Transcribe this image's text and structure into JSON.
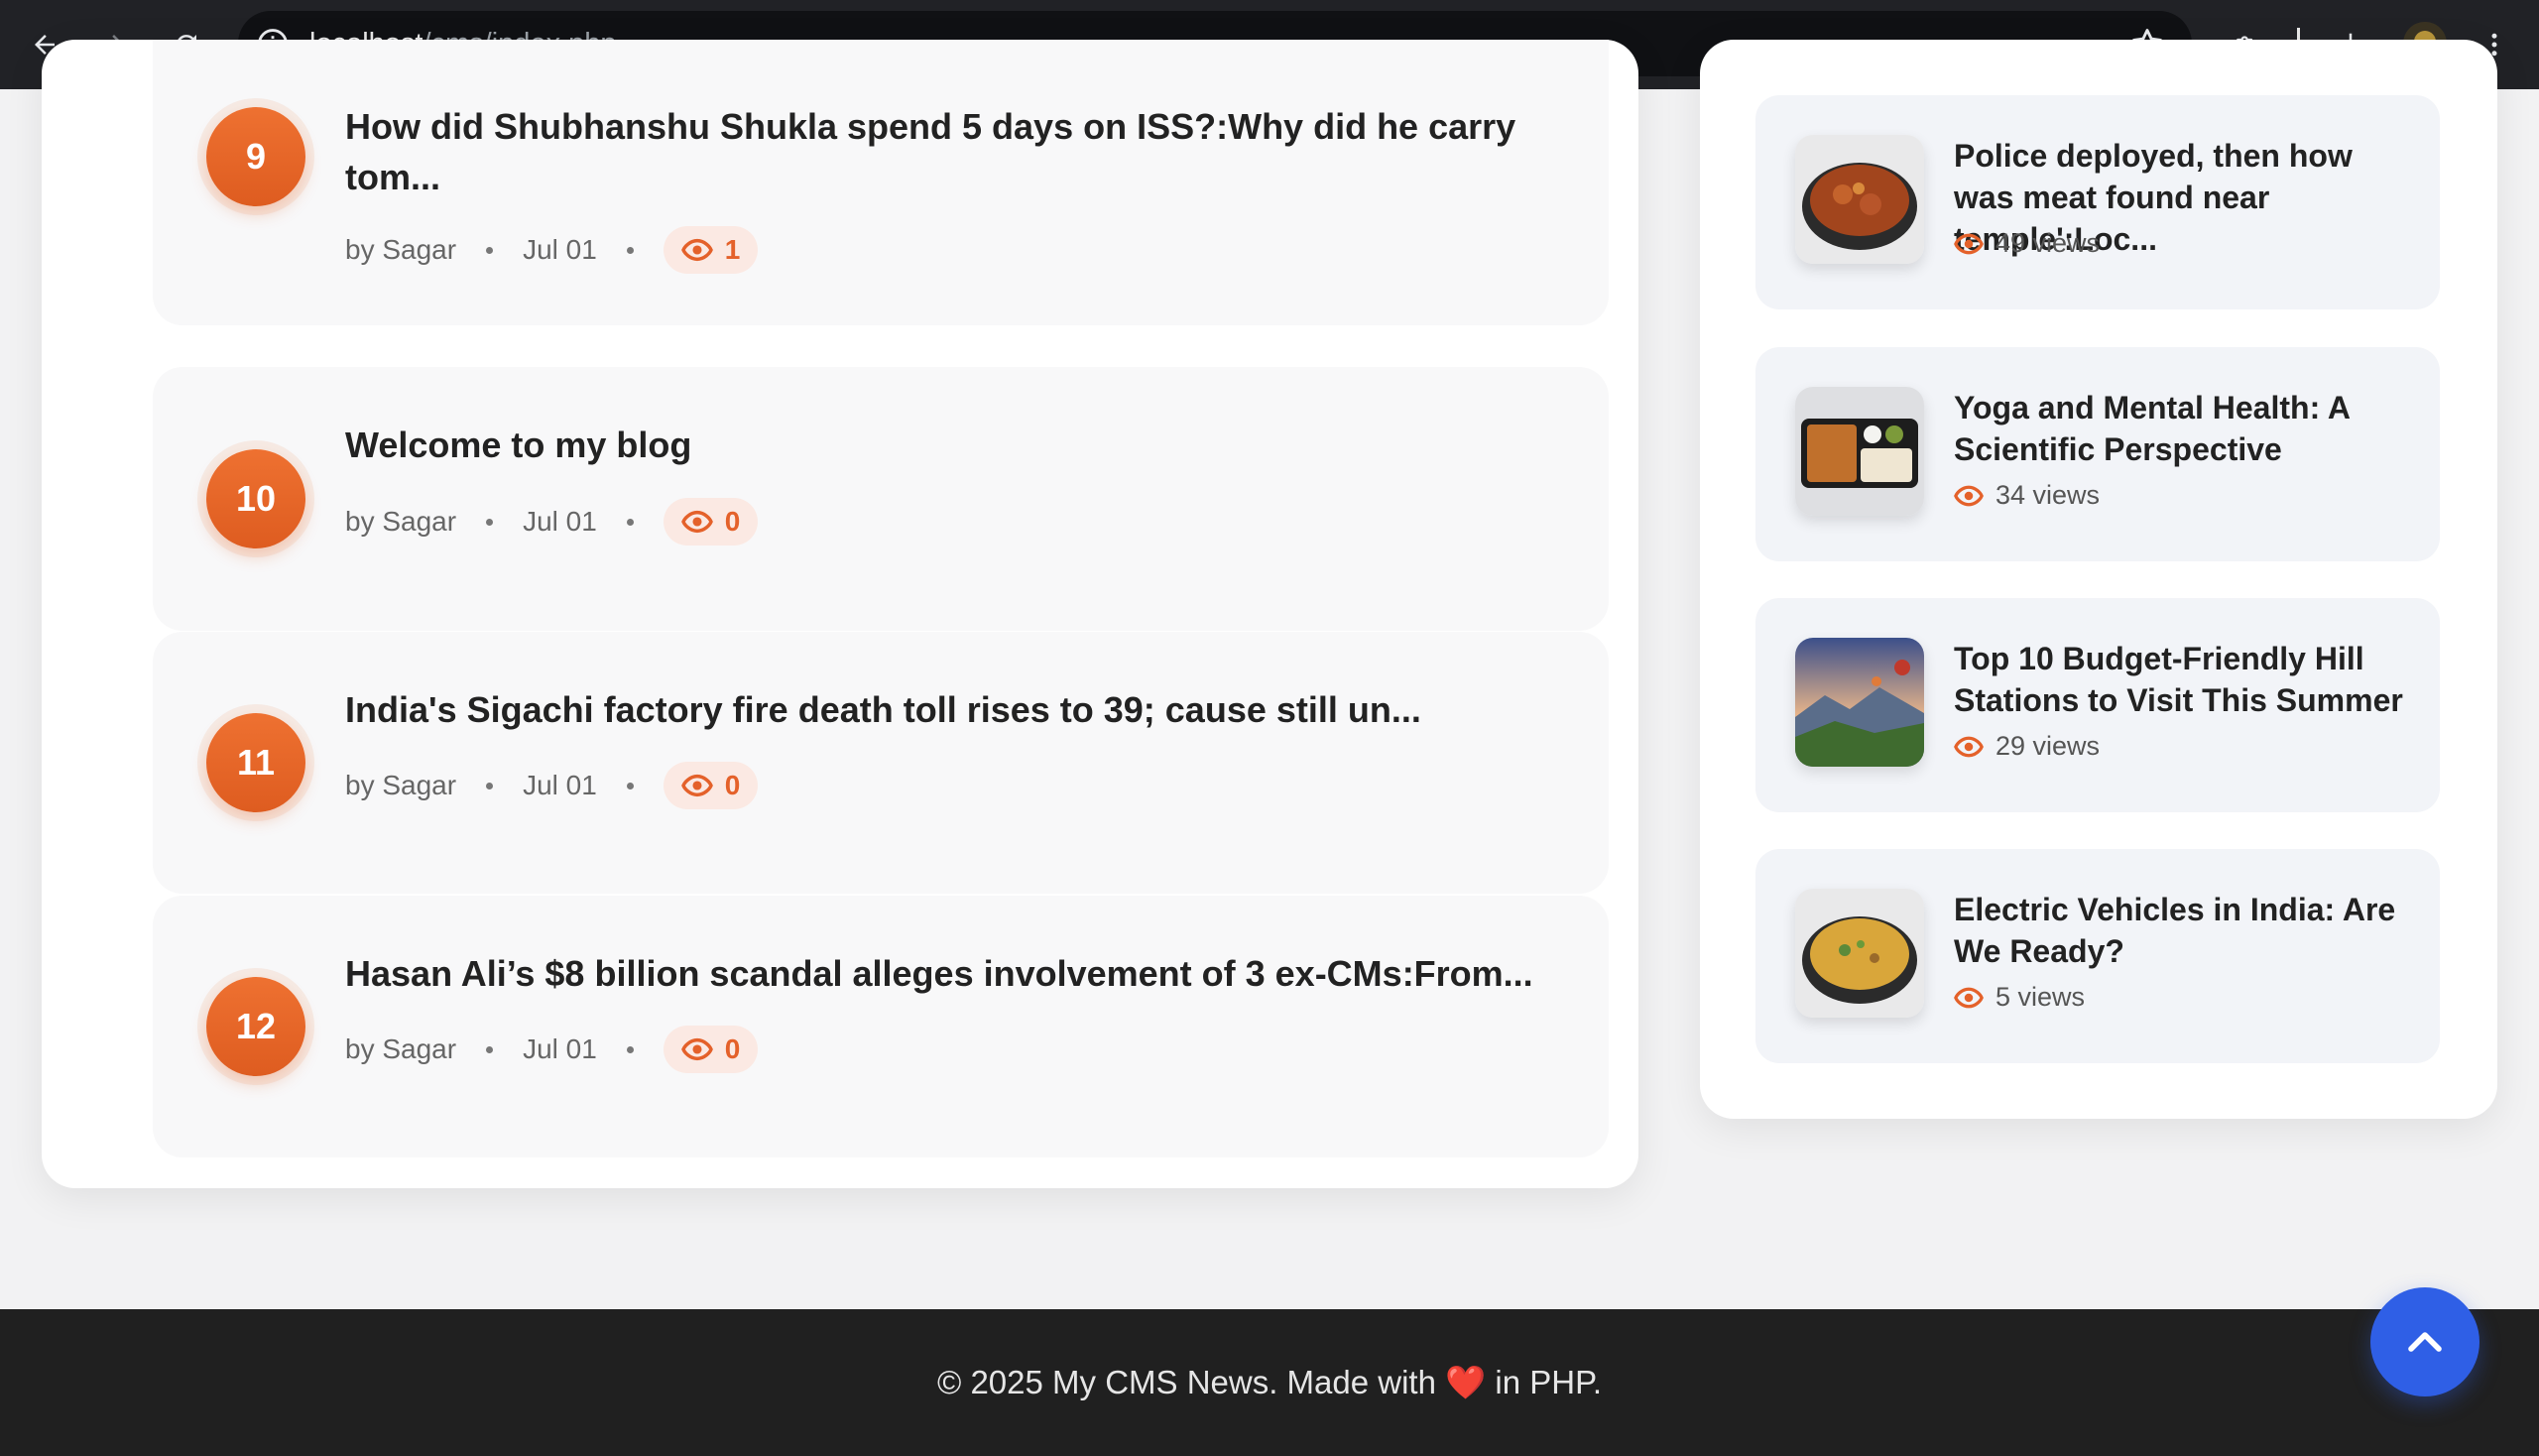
{
  "browser": {
    "url_host": "localhost",
    "url_path": "/cms/index.php"
  },
  "posts": [
    {
      "rank": "9",
      "title": "How did Shubhanshu Shukla spend 5 days on ISS?:Why did he carry tom...",
      "author": "by Sagar",
      "date": "Jul 01",
      "views": "1"
    },
    {
      "rank": "10",
      "title": "Welcome to my blog",
      "author": "by Sagar",
      "date": "Jul 01",
      "views": "0"
    },
    {
      "rank": "11",
      "title": "India's Sigachi factory fire death toll rises to 39; cause still un...",
      "author": "by Sagar",
      "date": "Jul 01",
      "views": "0"
    },
    {
      "rank": "12",
      "title": "Hasan Ali’s $8 billion scandal alleges involvement of 3 ex-CMs:From...",
      "author": "by Sagar",
      "date": "Jul 01",
      "views": "0"
    }
  ],
  "sidebar": {
    "items": [
      {
        "title": "Police deployed, then how was meat found near temple':Loc...",
        "views": "49 views",
        "thumb_icon": "curry-bowl-image"
      },
      {
        "title": "Yoga and Mental Health: A Scientific Perspective",
        "views": "34 views",
        "thumb_icon": "thali-tray-image"
      },
      {
        "title": "Top 10 Budget-Friendly Hill Stations to Visit This Summer",
        "views": "29 views",
        "thumb_icon": "hill-balloons-image"
      },
      {
        "title": "Electric Vehicles in India: Are We Ready?",
        "views": "5 views",
        "thumb_icon": "soup-bowl-image"
      }
    ]
  },
  "footer": {
    "prefix": "© 2025 My CMS News. Made with",
    "heart": "❤️",
    "suffix": "in PHP."
  },
  "colors": {
    "accent": "#e4612a",
    "top_button": "#2f5fe6",
    "footer_bg": "#202020"
  }
}
